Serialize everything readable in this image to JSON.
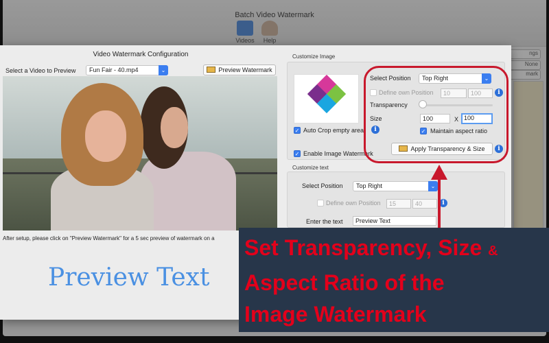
{
  "window": {
    "title": "Batch Video Watermark"
  },
  "toolbar": {
    "videos_label": "Videos",
    "help_label": "Help"
  },
  "bg_right": {
    "btn1": "ngs",
    "btn2": "None",
    "btn3": "mark"
  },
  "sheet": {
    "title": "Video Watermark Configuration",
    "select_video_label": "Select a Video to Preview",
    "selected_video": "Fun Fair - 40.mp4",
    "preview_button": "Preview Watermark",
    "instructions": "After setup, please click on \"Preview Watermark\" for a 5 sec preview of watermark on a",
    "preview_text": "Preview Text"
  },
  "customize_image": {
    "title": "Customize Image",
    "select_position_label": "Select Position",
    "position": "Top Right",
    "define_own_position_label": "Define own Position",
    "own_x": "10",
    "own_y": "100",
    "transparency_label": "Transparency",
    "size_label": "Size",
    "size_w": "100",
    "size_x": "X",
    "size_h": "100",
    "maintain_aspect_label": "Maintain aspect ratio",
    "auto_crop_label": "Auto Crop empty area",
    "enable_image_label": "Enable Image Watermark",
    "apply_button": "Apply Transparency & Size"
  },
  "customize_text": {
    "title": "Customize text",
    "select_position_label": "Select Position",
    "position": "Top Right",
    "define_own_position_label": "Define own Position",
    "own_x": "15",
    "own_y": "40",
    "enter_text_label": "Enter the text",
    "text_value": "Preview Text"
  },
  "caption": {
    "line1": "Set  Transparency, Size",
    "line1_amp": "&",
    "line2": "Aspect Ratio of the",
    "line3": "Image Watermark"
  },
  "colors": {
    "annotation_red": "#c8182c",
    "caption_bg": "#27364a",
    "accent_blue": "#3b7ef0"
  }
}
